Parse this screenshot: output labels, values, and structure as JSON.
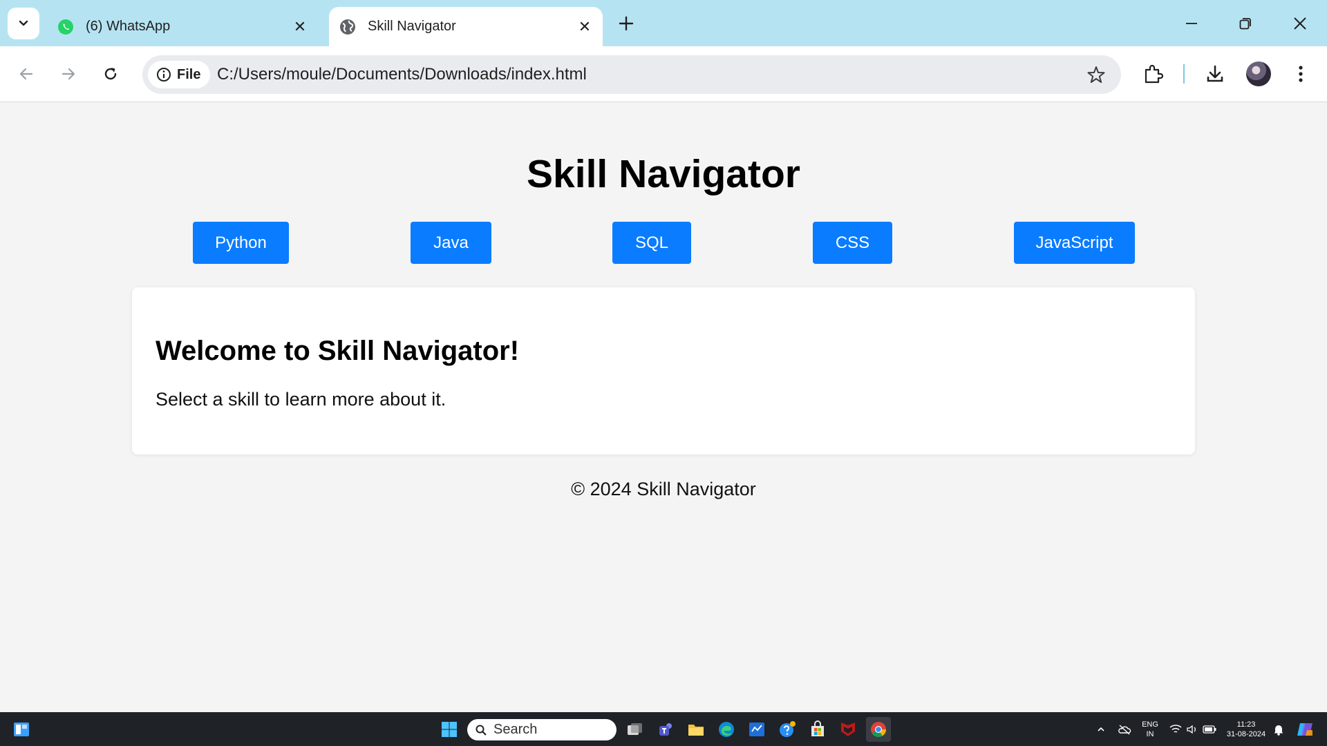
{
  "browser": {
    "tabs": [
      {
        "title": "(6) WhatsApp",
        "icon": "whatsapp-icon",
        "active": false
      },
      {
        "title": "Skill Navigator",
        "icon": "globe-icon",
        "active": true
      }
    ],
    "site_chip_label": "File",
    "url": "C:/Users/moule/Documents/Downloads/index.html"
  },
  "page": {
    "title": "Skill Navigator",
    "skills": [
      "Python",
      "Java",
      "SQL",
      "CSS",
      "JavaScript"
    ],
    "card": {
      "heading": "Welcome to Skill Navigator!",
      "text": "Select a skill to learn more about it."
    },
    "footer": "© 2024 Skill Navigator"
  },
  "taskbar": {
    "search_placeholder": "Search",
    "language": "ENG",
    "region": "IN",
    "time": "11:23",
    "date": "31-08-2024"
  },
  "colors": {
    "accent_button": "#0a7cff",
    "tab_strip": "#b6e3f2",
    "page_background": "#f4f4f4"
  }
}
